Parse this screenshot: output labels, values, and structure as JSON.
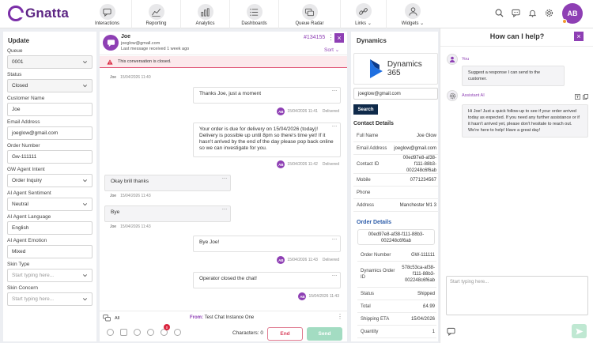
{
  "app": {
    "name": "Gnatta",
    "brand_color": "#8e3fb4"
  },
  "nav": [
    {
      "label": "Interactions",
      "icon": "chat-bubble-icon",
      "chevron": false
    },
    {
      "label": "Reporting",
      "icon": "line-chart-icon",
      "chevron": false
    },
    {
      "label": "Analytics",
      "icon": "bar-chart-icon",
      "chevron": false
    },
    {
      "label": "Dashboards",
      "icon": "list-icon",
      "chevron": false
    },
    {
      "label": "Queue Radar",
      "icon": "radar-icon",
      "chevron": false
    },
    {
      "label": "Links",
      "icon": "link-icon",
      "chevron": true
    },
    {
      "label": "Widgets",
      "icon": "user-icon",
      "chevron": true
    }
  ],
  "user": {
    "initials": "AB"
  },
  "update": {
    "title": "Update",
    "fields": [
      {
        "label": "Queue",
        "value": "0001",
        "type": "select",
        "grey": true
      },
      {
        "label": "Status",
        "value": "Closed",
        "type": "select",
        "grey": true
      },
      {
        "label": "Customer Name",
        "value": "Joe",
        "type": "text"
      },
      {
        "label": "Email Address",
        "value": "joeglow@gmail.com",
        "type": "text"
      },
      {
        "label": "Order Number",
        "value": "Gw-111111",
        "type": "text"
      },
      {
        "label": "GW Agent Intent",
        "value": "Order Inquiry",
        "type": "select"
      },
      {
        "label": "AI Agent Sentiment",
        "value": "Neutral",
        "type": "select"
      },
      {
        "label": "AI Agent Language",
        "value": "English",
        "type": "text"
      },
      {
        "label": "AI Agent Emotion",
        "value": "Mixed",
        "type": "text"
      },
      {
        "label": "Skin Type",
        "placeholder": "Start typing here...",
        "type": "select"
      },
      {
        "label": "Skin Concern",
        "placeholder": "Start typing here...",
        "type": "select"
      }
    ]
  },
  "chat": {
    "name": "Joe",
    "email": "joeglow@gmail.com",
    "last_message": "Last message received 1 week ago",
    "id": "#134155",
    "sort_label": "Sort",
    "closed_notice": "This conversation is closed.",
    "top_meta": {
      "name": "Joe",
      "time": "15/04/2026 11:40"
    },
    "messages": [
      {
        "dir": "out",
        "text": "Thanks Joe, just a moment",
        "initials": "AB",
        "time": "15/04/2026 11:41",
        "status": "Delivered"
      },
      {
        "dir": "out",
        "text": "Your order is due for delivery on 15/04/2026 (today)! Delivery is possible up until 8pm so there's time yet! If it hasn't arrived by the end of the day please pop back online so we can investigate for you.",
        "initials": "AB",
        "time": "15/04/2026 11:42",
        "status": "Delivered"
      },
      {
        "dir": "in",
        "text": "Okay brill thanks",
        "name": "Joe",
        "time": "15/04/2026 11:43"
      },
      {
        "dir": "in",
        "text": "Bye",
        "name": "Joe",
        "time": "15/04/2026 11:43"
      },
      {
        "dir": "out",
        "text": "Bye Joe!",
        "initials": "AB",
        "time": "15/04/2026 11:43",
        "status": "Delivered"
      },
      {
        "dir": "out",
        "text": "Operator closed the chat!",
        "initials": "AB",
        "time": "15/04/2026 11:43",
        "status": ""
      }
    ],
    "compose": {
      "all_label": "All",
      "from_prefix": "From:",
      "from_value": "Test Chat Instance One",
      "badge": "0",
      "chars_label": "Characters: 0",
      "end_label": "End",
      "send_label": "Send"
    }
  },
  "dynamics": {
    "title": "Dynamics",
    "logo_text": "Dynamics 365",
    "search_value": "joeglow@gmail.com",
    "search_button": "Search",
    "contact_title": "Contact Details",
    "contact": [
      {
        "k": "Full Name",
        "v": "Joe Glow"
      },
      {
        "k": "Email Address",
        "v": "joeglow@gmail.com"
      },
      {
        "k": "Contact ID",
        "v": "00ed97e8-af38-f111-88b3-002248c6f6ab"
      },
      {
        "k": "Mobile",
        "v": "0771234567"
      },
      {
        "k": "Phone",
        "v": ""
      },
      {
        "k": "Address",
        "v": "Manchester M1 3"
      }
    ],
    "order_title": "Order Details",
    "order_id": "00ed97e8-af38-f111-88b3-002248c6f6ab",
    "order": [
      {
        "k": "Order Number",
        "v": "GW-111111"
      },
      {
        "k": "Dynamics Order ID",
        "v": "578c53ca-af38-f111-88b3-002248c6f6ab"
      },
      {
        "k": "Status",
        "v": "Shipped"
      },
      {
        "k": "Total",
        "v": "£4.99"
      },
      {
        "k": "Shipping ETA",
        "v": "15/04/2026"
      },
      {
        "k": "Quantity",
        "v": "1"
      }
    ]
  },
  "ai": {
    "title": "How can I help?",
    "you_label": "You",
    "you_msg": "Suggest a response I can send to the customer.",
    "assistant_label": "Assistant AI",
    "assistant_msg": "Hi Joe! Just a quick follow-up to see if your order arrived today as expected. If you need any further assistance or if it hasn't arrived yet, please don't hesitate to reach out. We're here to help! Have a great day!",
    "input_placeholder": "Start typing here..."
  }
}
